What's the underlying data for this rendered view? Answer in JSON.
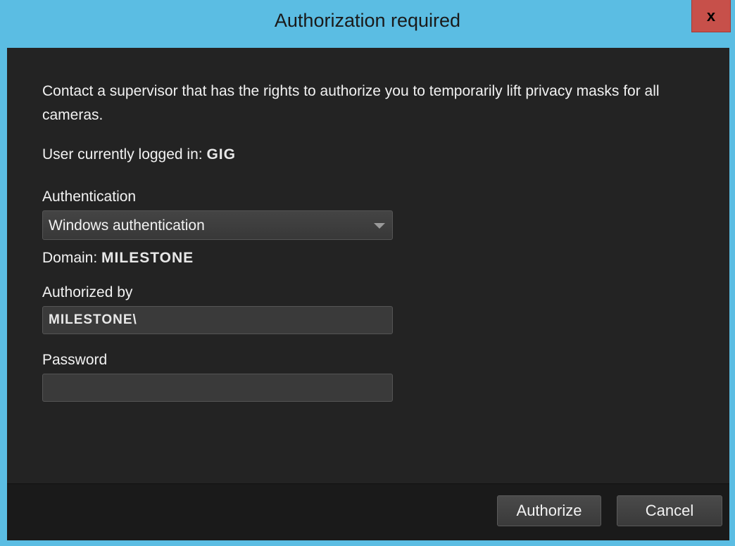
{
  "window": {
    "title": "Authorization required",
    "close_label": "x"
  },
  "content": {
    "description": "Contact a supervisor that has the rights to authorize you to temporarily lift privacy masks for all cameras.",
    "user_label": "User currently logged in:",
    "user_value": "GIG",
    "authentication_label": "Authentication",
    "authentication_selected": "Windows authentication",
    "domain_label": "Domain:",
    "domain_value": "MILESTONE",
    "authorized_by_label": "Authorized by",
    "authorized_by_value": "MILESTONE\\",
    "password_label": "Password",
    "password_value": ""
  },
  "footer": {
    "authorize_label": "Authorize",
    "cancel_label": "Cancel"
  }
}
